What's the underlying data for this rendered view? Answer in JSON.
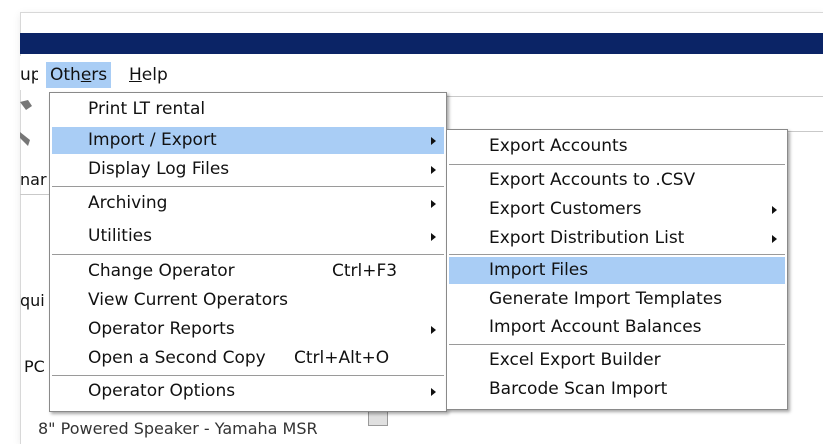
{
  "menubar": {
    "prev_label_partial": "up",
    "others_label_pre": "Oth",
    "others_label_u": "e",
    "others_label_post": "rs",
    "help_label_u": "H",
    "help_label_post": "elp"
  },
  "background": {
    "left_text_1": "nar",
    "left_text_2": "qui",
    "left_text_3": "PC",
    "speaker_text": "8\" Powered Speaker - Yamaha MSR"
  },
  "others_menu": {
    "items": [
      {
        "label": "Print LT rental"
      },
      {
        "label": "Import / Export",
        "submenu": true
      },
      {
        "label": "Display Log Files",
        "submenu": true
      },
      {
        "label": "Archiving",
        "submenu": true
      },
      {
        "label": "Utilities",
        "submenu": true
      },
      {
        "label": "Change Operator",
        "shortcut": "Ctrl+F3"
      },
      {
        "label": "View Current Operators"
      },
      {
        "label": "Operator Reports",
        "submenu": true
      },
      {
        "label": "Open a Second Copy",
        "shortcut": "Ctrl+Alt+O"
      },
      {
        "label": "Operator Options",
        "submenu": true
      }
    ]
  },
  "import_export_menu": {
    "items": [
      {
        "label": "Export Accounts"
      },
      {
        "label": "Export Accounts to .CSV"
      },
      {
        "label": "Export Customers",
        "submenu": true
      },
      {
        "label": "Export Distribution List",
        "submenu": true
      },
      {
        "label": "Import Files"
      },
      {
        "label": "Generate Import Templates"
      },
      {
        "label": "Import Account Balances"
      },
      {
        "label": "Excel Export Builder"
      },
      {
        "label": "Barcode Scan Import"
      }
    ]
  },
  "colors": {
    "titlebar": "#0b2466",
    "highlight": "#a9cdf5"
  }
}
